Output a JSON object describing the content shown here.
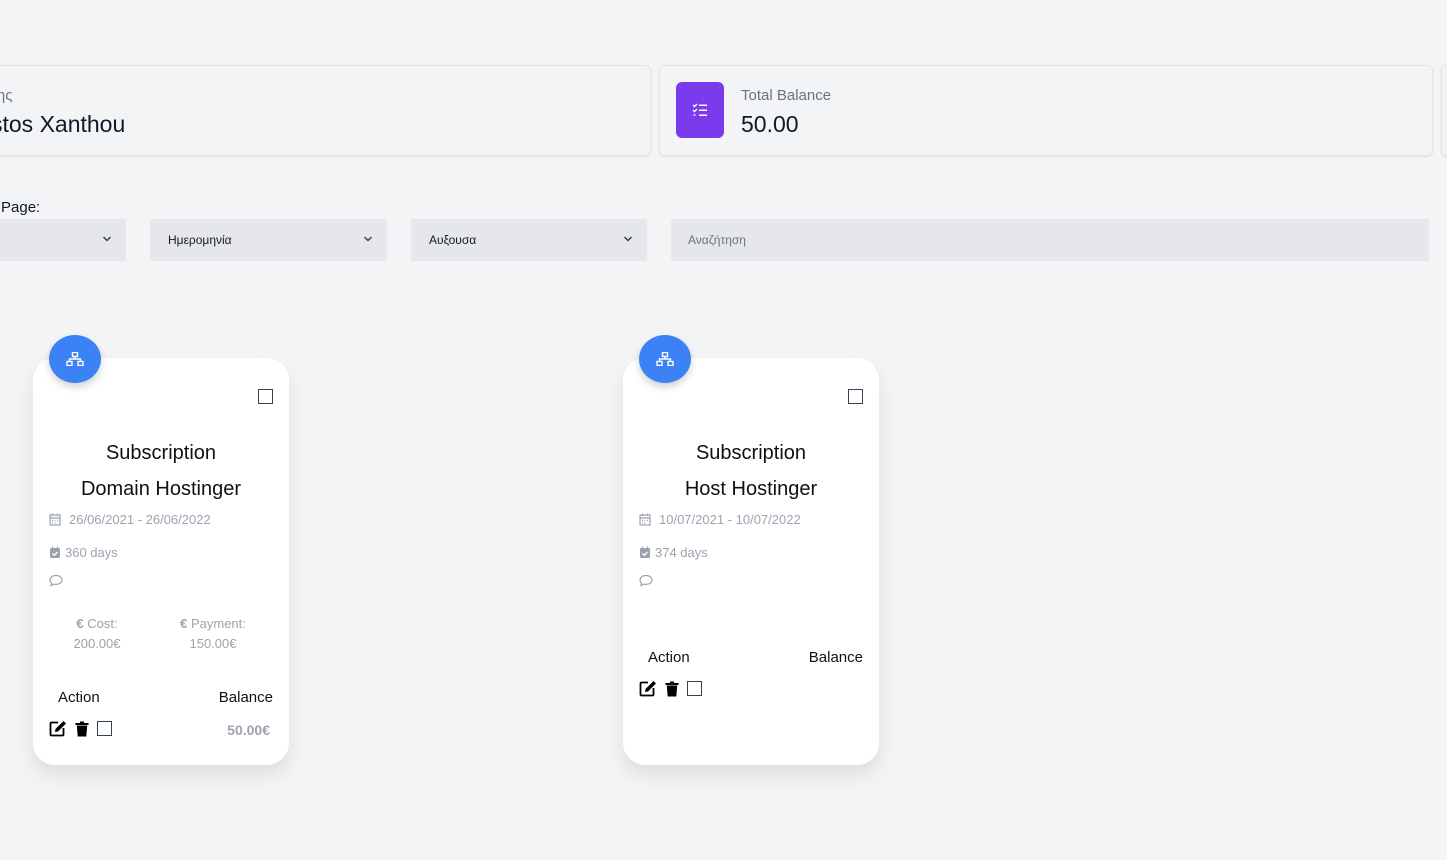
{
  "stats": {
    "user_label": "της",
    "user_value": "stos Xanthou",
    "balance_label": "Total Balance",
    "balance_value": "50.00",
    "balance_icon": "list-check-icon",
    "accent_color": "#7c3aed"
  },
  "filters": {
    "per_page_label": "Page:",
    "per_page_value": "",
    "sort_field": "Ημερομηνία",
    "sort_order": "Αυξουσα",
    "search_placeholder": "Αναζήτηση"
  },
  "cards": [
    {
      "icon": "sitemap-icon",
      "type": "Subscription",
      "name": "Domain Hostinger",
      "date_range": "26/06/2021 - 26/06/2022",
      "days": "360 days",
      "cost_label": "Cost:",
      "cost_value": "200.00€",
      "payment_label": "Payment:",
      "payment_value": "150.00€",
      "action_label": "Action",
      "balance_label": "Balance",
      "balance_value": "50.00€"
    },
    {
      "icon": "sitemap-icon",
      "type": "Subscription",
      "name": "Host Hostinger",
      "date_range": "10/07/2021 - 10/07/2022",
      "days": "374 days",
      "action_label": "Action",
      "balance_label": "Balance"
    }
  ],
  "colors": {
    "badge": "#3b82f6",
    "muted_text": "#9ca3af"
  }
}
